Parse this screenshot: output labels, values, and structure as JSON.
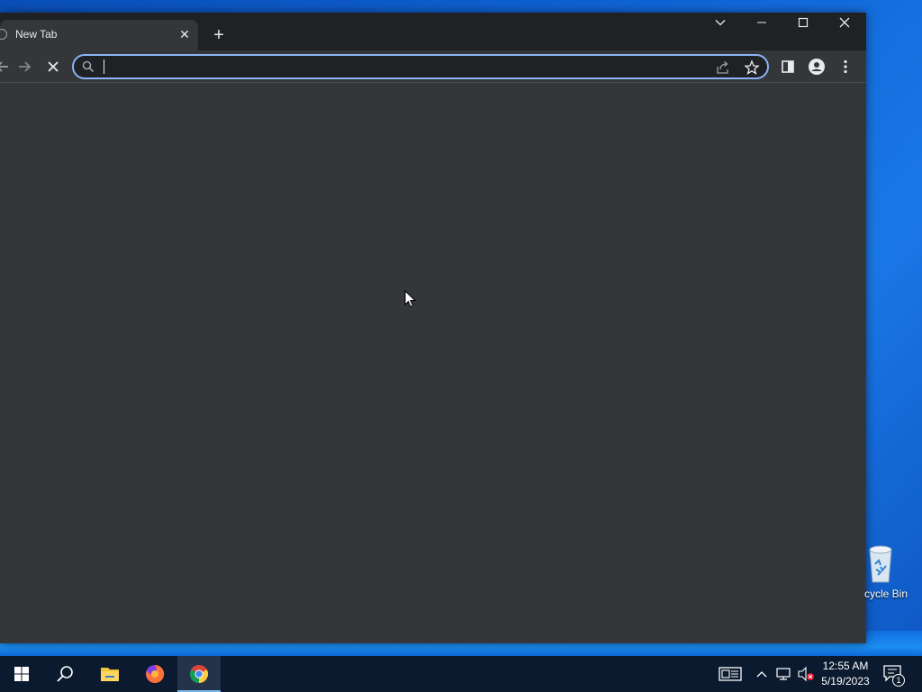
{
  "browser": {
    "tab": {
      "title": "New Tab",
      "close_glyph": "✕",
      "favicon": "chrome-globe-icon"
    },
    "new_tab_glyph": "+",
    "window_controls": [
      "tab-search-icon",
      "minimize-icon",
      "maximize-icon",
      "close-icon"
    ],
    "omnibox": {
      "value": "",
      "placeholder": ""
    },
    "toolbar_icons": [
      "back-icon",
      "forward-icon",
      "stop-icon",
      "search-icon",
      "share-icon",
      "star-icon",
      "side-panel-icon",
      "profile-icon",
      "menu-icon"
    ],
    "colors": {
      "frame": "#202124",
      "toolbar": "#35363a",
      "focus_ring": "#8ab4f8",
      "text": "#e8eaed"
    }
  },
  "desktop": {
    "recycle_bin_label": "cycle Bin"
  },
  "taskbar": {
    "apps": [
      "windows-start-icon",
      "search-icon",
      "file-explorer-icon",
      "firefox-icon",
      "chrome-icon"
    ],
    "active_app": "chrome-icon",
    "tray": [
      "news-widget-icon",
      "chevron-up-icon",
      "network-icon",
      "volume-muted-icon"
    ],
    "clock": {
      "time": "12:55 AM",
      "date": "5/19/2023"
    },
    "notification_count": "1"
  }
}
